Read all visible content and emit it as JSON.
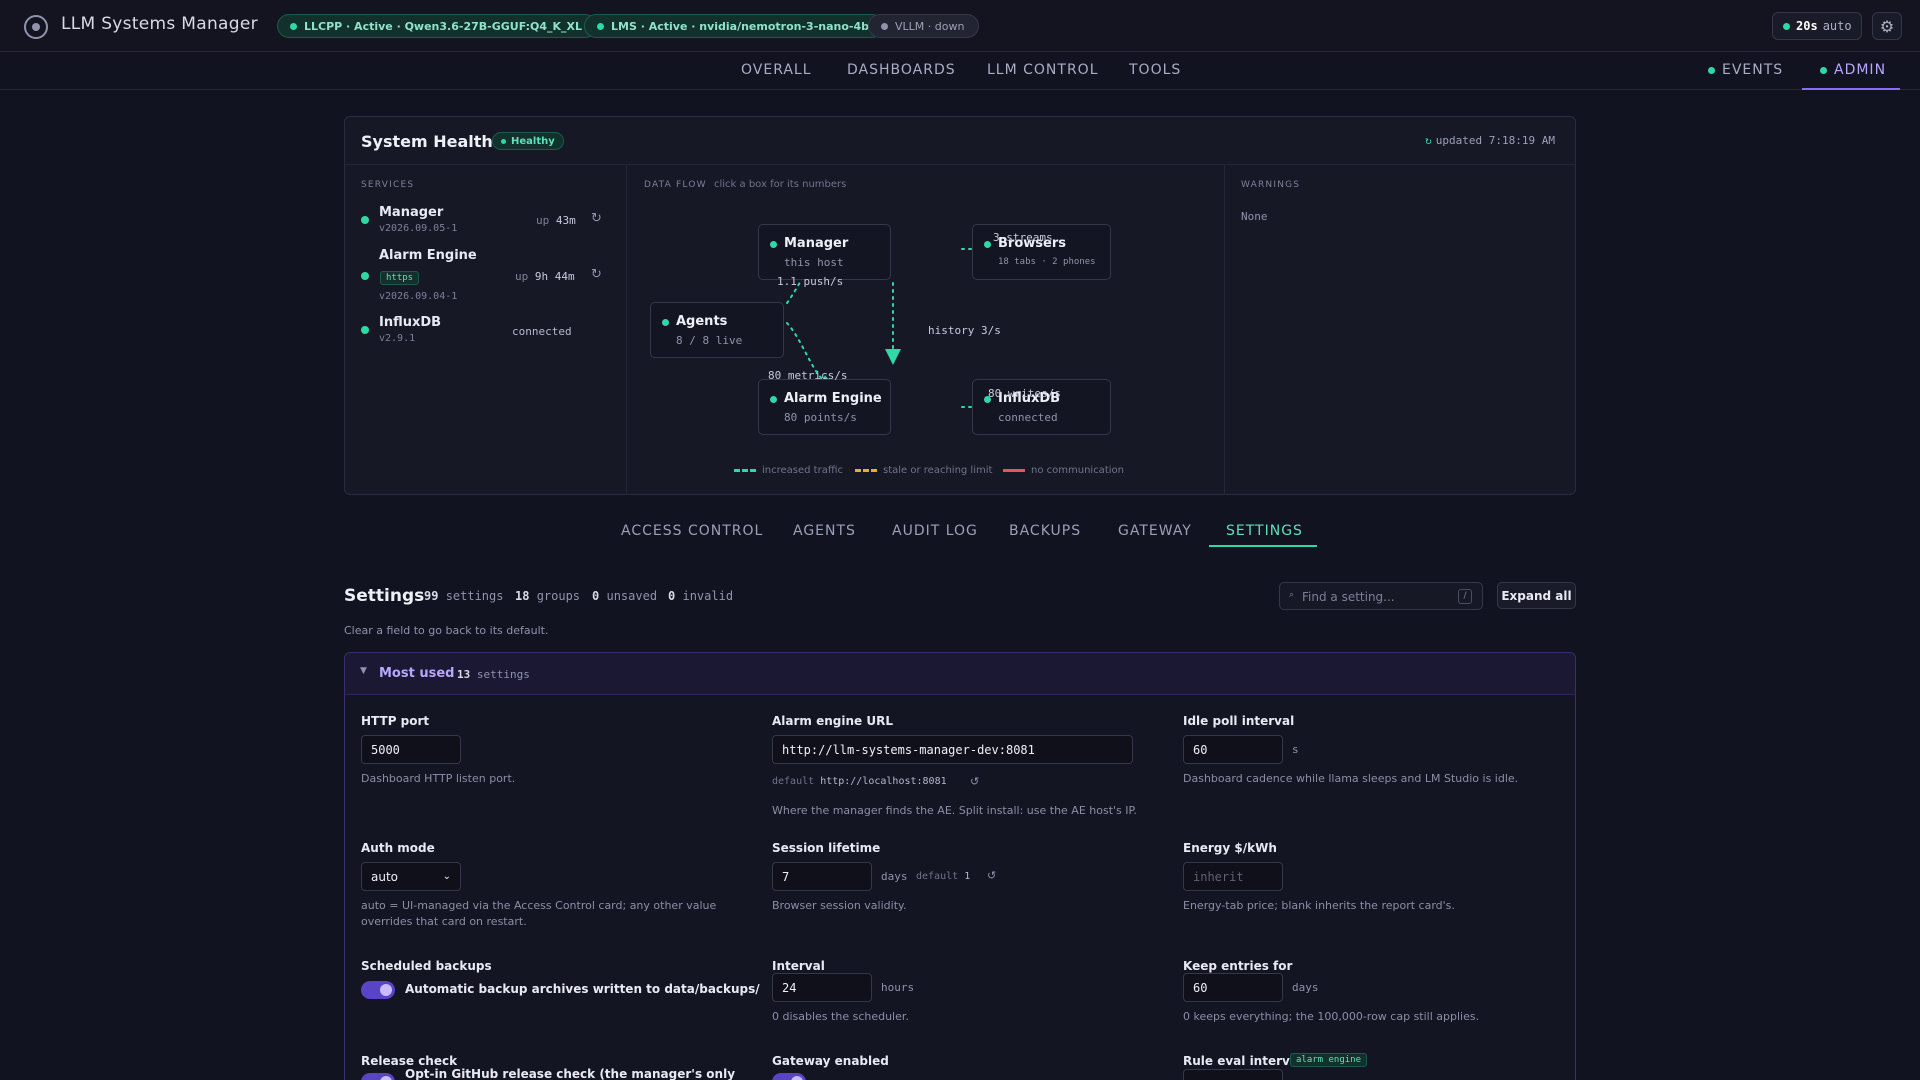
{
  "header": {
    "title": "LLM Systems Manager",
    "pills": {
      "llcpp": "LLCPP · Active · Qwen3.6-27B-GGUF:Q4_K_XL",
      "lms": "LMS · Active · nvidia/nemotron-3-nano-4b",
      "vllm": "VLLM · down"
    },
    "refresh_value": "20s",
    "refresh_mode": "auto"
  },
  "nav": {
    "items": [
      "OVERALL",
      "DASHBOARDS",
      "LLM CONTROL",
      "TOOLS"
    ],
    "right": [
      "EVENTS",
      "ADMIN"
    ]
  },
  "health": {
    "title": "System Health",
    "status": "Healthy",
    "updated": "updated 7:18:19 AM",
    "services_label": "SERVICES",
    "services": [
      {
        "name": "Manager",
        "version": "v2026.09.05-1",
        "up_prefix": "up",
        "uptime": "43m"
      },
      {
        "name": "Alarm Engine",
        "badge": "https",
        "version": "v2026.09.04-1",
        "up_prefix": "up",
        "uptime": "9h 44m"
      },
      {
        "name": "InfluxDB",
        "version": "v2.9.1",
        "status": "connected"
      }
    ],
    "dataflow_label": "DATA FLOW",
    "dataflow_hint": "click a box for its numbers",
    "nodes": {
      "manager": {
        "name": "Manager",
        "sub": "this host"
      },
      "browsers": {
        "name": "Browsers",
        "sub": "18 tabs · 2 phones"
      },
      "agents": {
        "name": "Agents",
        "sub": "8 / 8 live"
      },
      "alarm": {
        "name": "Alarm Engine",
        "sub": "80 points/s"
      },
      "influx": {
        "name": "InfluxDB",
        "sub": "connected"
      }
    },
    "flows": {
      "streams": "3 streams",
      "push": "1.1 push/s",
      "history": "history 3/s",
      "metrics": "80 metrics/s",
      "writes": "80 writes/s"
    },
    "legend": {
      "increased": "increased traffic",
      "stale": "stale or reaching limit",
      "nocomm": "no communication"
    },
    "legend_colors": {
      "increased": "#2fd9a6",
      "stale": "#f0a830",
      "nocomm": "#e05a5a"
    },
    "warnings_label": "WARNINGS",
    "warnings": "None"
  },
  "subtabs": [
    "ACCESS CONTROL",
    "AGENTS",
    "AUDIT LOG",
    "BACKUPS",
    "GATEWAY",
    "SETTINGS"
  ],
  "settings": {
    "title": "Settings",
    "stats": {
      "settings": "99",
      "settings_label": "settings",
      "groups": "18",
      "groups_label": "groups",
      "unsaved": "0",
      "unsaved_label": "unsaved",
      "invalid": "0",
      "invalid_label": "invalid"
    },
    "search_placeholder": "Find a setting...",
    "search_key": "/",
    "expand_label": "Expand all",
    "hint": "Clear a field to go back to its default.",
    "group": {
      "name": "Most used",
      "count": "13",
      "count_label": "settings"
    },
    "fields": {
      "http_port": {
        "label": "HTTP port",
        "value": "5000",
        "help": "Dashboard HTTP listen port."
      },
      "alarm_url": {
        "label": "Alarm engine URL",
        "value": "http://llm-systems-manager-dev:8081",
        "default_label": "default",
        "default_value": "http://localhost:8081",
        "help": "Where the manager finds the AE. Split install: use the AE host's IP."
      },
      "idle_poll": {
        "label": "Idle poll interval",
        "value": "60",
        "unit": "s",
        "help": "Dashboard cadence while llama sleeps and LM Studio is idle."
      },
      "auth_mode": {
        "label": "Auth mode",
        "value": "auto",
        "help1": "auto = UI-managed via the Access Control card; any other value",
        "help2": "overrides that card on restart."
      },
      "session": {
        "label": "Session lifetime",
        "value": "7",
        "unit": "days",
        "default_label": "default",
        "default_value": "1",
        "help": "Browser session validity."
      },
      "energy": {
        "label": "Energy $/kWh",
        "placeholder": "inherit",
        "help": "Energy-tab price; blank inherits the report card's."
      },
      "backups": {
        "label": "Scheduled backups",
        "toggle_text": "Automatic backup archives written to data/backups/"
      },
      "interval": {
        "label": "Interval",
        "value": "24",
        "unit": "hours",
        "help": "0 disables the scheduler."
      },
      "keep": {
        "label": "Keep entries for",
        "value": "60",
        "unit": "days",
        "help": "0 keeps everything; the 100,000-row cap still applies."
      },
      "release": {
        "label": "Release check",
        "toggle_text": "Opt-in GitHub release check (the manager's only"
      },
      "gateway": {
        "label": "Gateway enabled"
      },
      "rule_eval": {
        "label": "Rule eval interval",
        "tag": "alarm engine"
      }
    }
  }
}
